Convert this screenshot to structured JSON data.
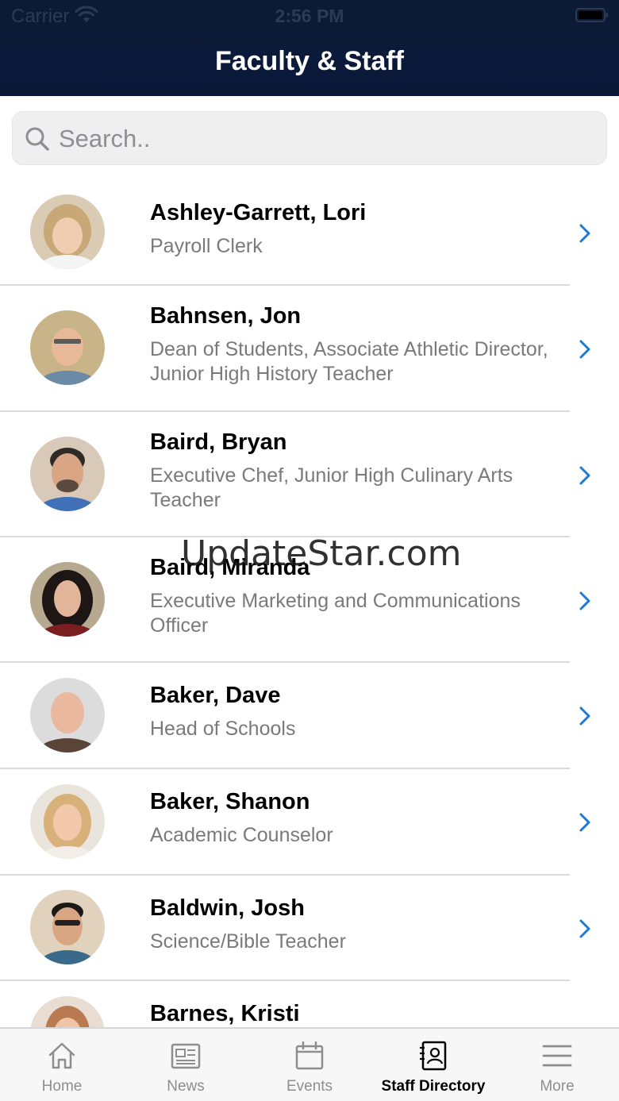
{
  "status_bar": {
    "carrier": "Carrier",
    "time": "2:56 PM"
  },
  "header": {
    "title": "Faculty & Staff"
  },
  "search": {
    "placeholder": "Search.."
  },
  "staff": [
    {
      "name": "Ashley-Garrett, Lori",
      "title": "Payroll Clerk"
    },
    {
      "name": "Bahnsen, Jon",
      "title": "Dean of Students, Associate Athletic Director, Junior High History Teacher"
    },
    {
      "name": "Baird, Bryan",
      "title": "Executive Chef, Junior High Culinary Arts Teacher"
    },
    {
      "name": "Baird, Miranda",
      "title": "Executive Marketing and Communications Officer"
    },
    {
      "name": "Baker, Dave",
      "title": "Head of Schools"
    },
    {
      "name": "Baker, Shanon",
      "title": "Academic Counselor"
    },
    {
      "name": "Baldwin, Josh",
      "title": "Science/Bible Teacher"
    },
    {
      "name": "Barnes, Kristi",
      "title": ""
    }
  ],
  "watermark": "UpdateStar.com",
  "tabbar": {
    "tabs": [
      {
        "label": "Home",
        "icon": "home-icon"
      },
      {
        "label": "News",
        "icon": "news-icon"
      },
      {
        "label": "Events",
        "icon": "calendar-icon"
      },
      {
        "label": "Staff Directory",
        "icon": "contact-card-icon"
      },
      {
        "label": "More",
        "icon": "menu-icon"
      }
    ],
    "active": "Staff Directory"
  },
  "colors": {
    "header_bg": "#0b1a3a",
    "chevron": "#1a7ad8",
    "name_text": "#000000",
    "title_text": "#7a7a7a",
    "tab_inactive": "#8e8e8e"
  }
}
